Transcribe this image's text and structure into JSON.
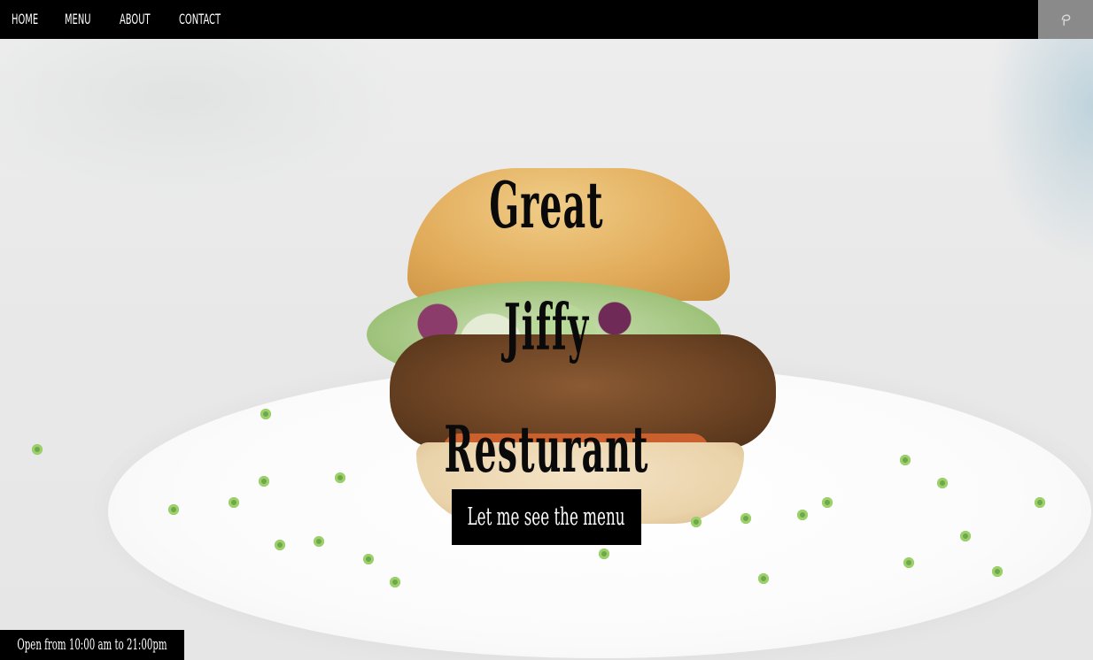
{
  "nav": {
    "items": [
      {
        "label": "HOME"
      },
      {
        "label": "MENU"
      },
      {
        "label": "ABOUT"
      },
      {
        "label": "CONTACT"
      }
    ],
    "corner_icon": "leaf-logo-icon"
  },
  "hero": {
    "title_lines": [
      "Great",
      "Jiffy",
      "Resturant"
    ],
    "cta_label": "Let me see the menu"
  },
  "footer": {
    "hours": "Open from 10:00 am to 21:00pm"
  },
  "colors": {
    "bar": "#000000",
    "text_light": "#ffffff",
    "title": "#0a0a0a",
    "corner_button": "#8a8a8a"
  }
}
